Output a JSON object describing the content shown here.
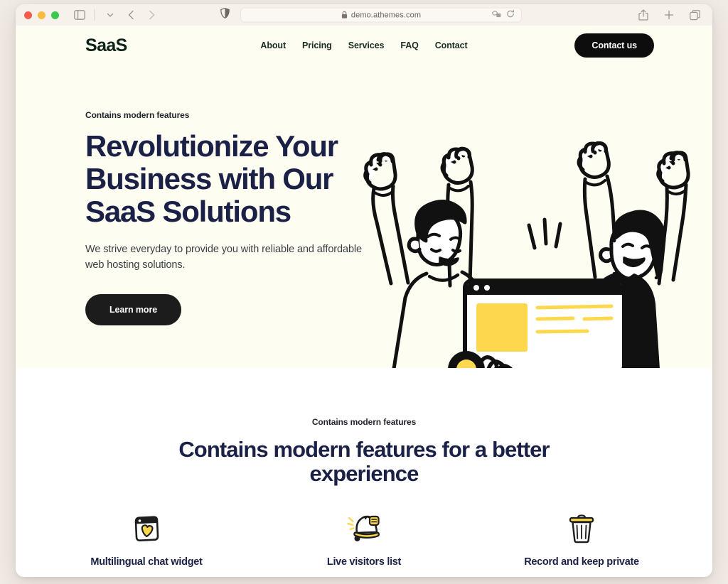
{
  "browser": {
    "url": "demo.athemes.com",
    "lock_icon": "lock-icon",
    "traffic_lights": [
      "close-red",
      "minimize-yellow",
      "maximize-green"
    ],
    "toolbar_icons": [
      "sidebar-toggle-icon",
      "chevron-down-icon",
      "back-chevron-icon",
      "forward-chevron-icon",
      "shield-icon",
      "extensions-icon",
      "reload-icon",
      "share-icon",
      "new-tab-icon",
      "tab-overview-icon"
    ]
  },
  "site": {
    "logo": "SaaS",
    "nav": [
      {
        "label": "About"
      },
      {
        "label": "Pricing"
      },
      {
        "label": "Services"
      },
      {
        "label": "FAQ"
      },
      {
        "label": "Contact"
      }
    ],
    "cta_button": "Contact us"
  },
  "hero": {
    "eyebrow": "Contains modern features",
    "title_line1": "Revolutionize Your",
    "title_line2": "Business with Our",
    "title_line3": "SaaS Solutions",
    "subtitle": "We strive everyday to provide you with reliable and affordable web hosting solutions.",
    "button": "Learn more",
    "illustration": "two-people-cheering-with-browser-window-illustration"
  },
  "features": {
    "eyebrow": "Contains modern features",
    "heading": "Contains modern features for a better experience",
    "items": [
      {
        "label": "Multilingual chat widget",
        "icon": "browser-heart-icon"
      },
      {
        "label": "Live visitors list",
        "icon": "bell-notification-icon"
      },
      {
        "label": "Record and keep private",
        "icon": "trash-can-icon"
      }
    ]
  },
  "colors": {
    "hero_background": "#fdfdf2",
    "page_background": "#ffffff",
    "heading_navy": "#1b2146",
    "accent_yellow": "#fdd84e",
    "button_black": "#0d0d0d",
    "logo_dark_green": "#0e2119"
  }
}
